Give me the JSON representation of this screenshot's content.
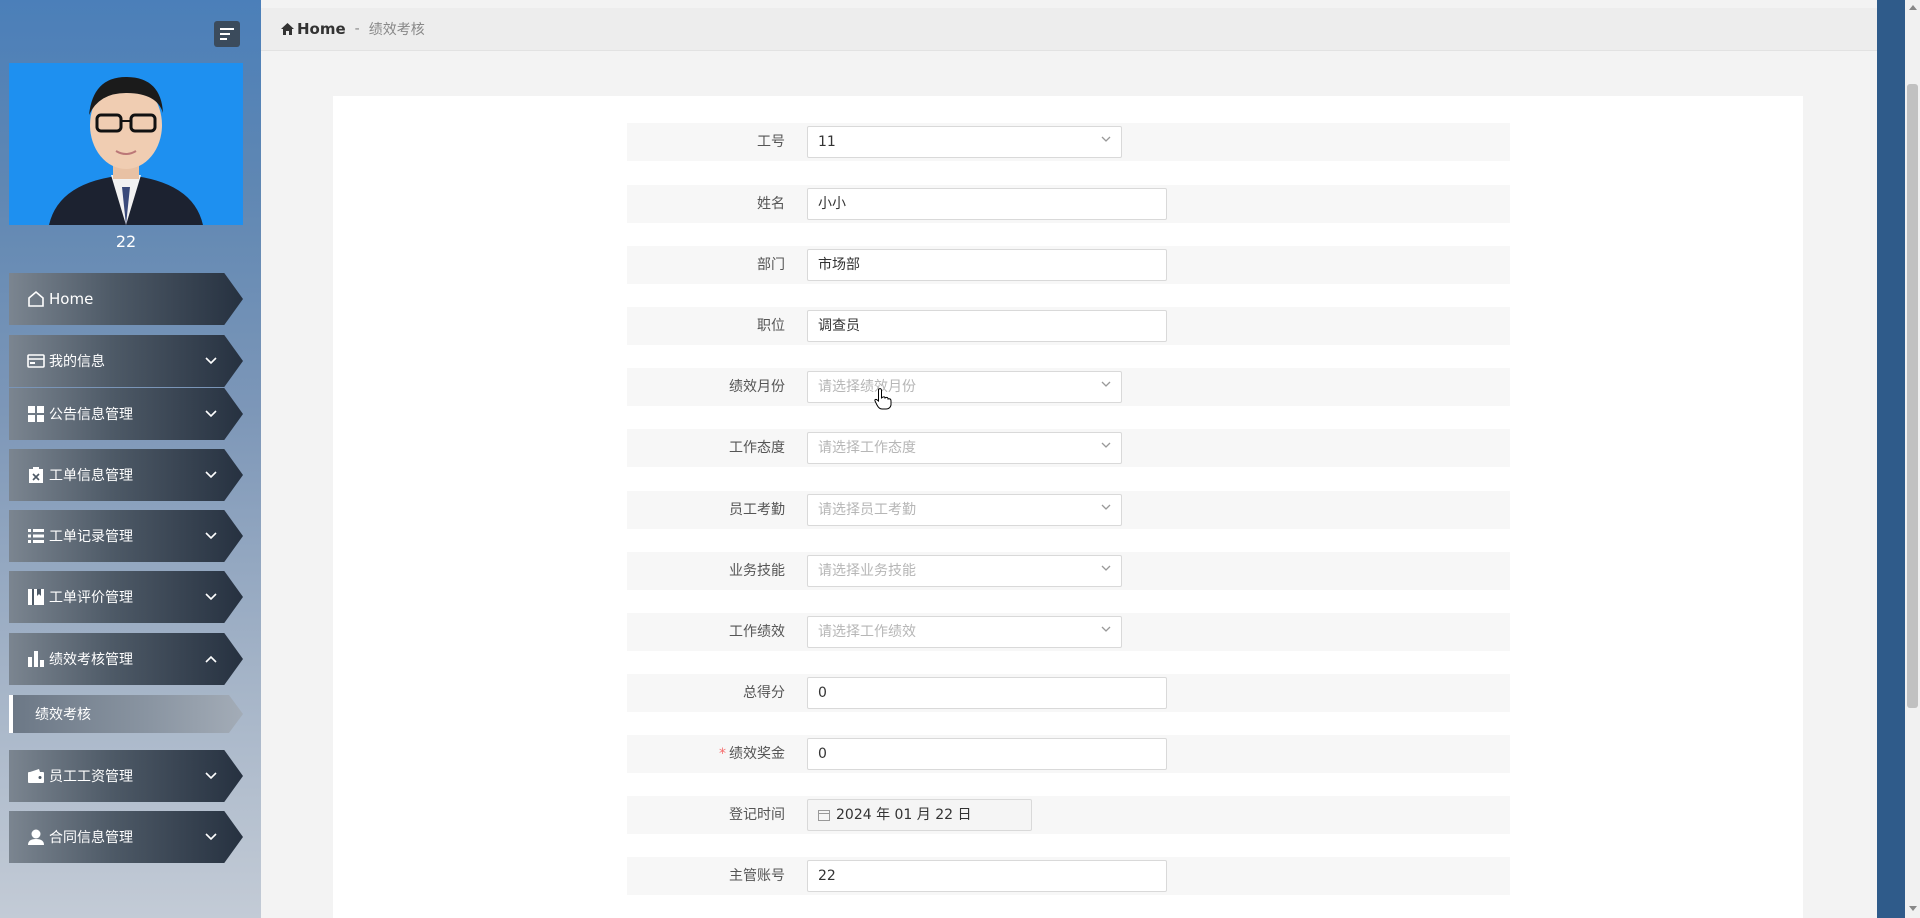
{
  "user": {
    "name": "22"
  },
  "breadcrumb": {
    "home": "Home",
    "separator": "-",
    "current": "绩效考核"
  },
  "nav": {
    "home": "Home",
    "items": [
      {
        "label": "我的信息",
        "icon": "id-card-icon",
        "expanded": false
      },
      {
        "label": "公告信息管理",
        "icon": "grid-icon",
        "expanded": false
      },
      {
        "label": "工单信息管理",
        "icon": "clipboard-icon",
        "expanded": false
      },
      {
        "label": "工单记录管理",
        "icon": "list-icon",
        "expanded": false
      },
      {
        "label": "工单评价管理",
        "icon": "book-icon",
        "expanded": false
      },
      {
        "label": "绩效考核管理",
        "icon": "bar-chart-icon",
        "expanded": true
      },
      {
        "label": "员工工资管理",
        "icon": "wallet-icon",
        "expanded": false
      },
      {
        "label": "合同信息管理",
        "icon": "user-icon",
        "expanded": false
      }
    ],
    "sub_active": "绩效考核"
  },
  "form": {
    "fields": [
      {
        "label": "工号",
        "type": "select",
        "value": "11",
        "placeholder": ""
      },
      {
        "label": "姓名",
        "type": "input",
        "value": "小小"
      },
      {
        "label": "部门",
        "type": "input",
        "value": "市场部"
      },
      {
        "label": "职位",
        "type": "input",
        "value": "调查员"
      },
      {
        "label": "绩效月份",
        "type": "select",
        "value": "",
        "placeholder": "请选择绩效月份"
      },
      {
        "label": "工作态度",
        "type": "select",
        "value": "",
        "placeholder": "请选择工作态度"
      },
      {
        "label": "员工考勤",
        "type": "select",
        "value": "",
        "placeholder": "请选择员工考勤"
      },
      {
        "label": "业务技能",
        "type": "select",
        "value": "",
        "placeholder": "请选择业务技能"
      },
      {
        "label": "工作绩效",
        "type": "select",
        "value": "",
        "placeholder": "请选择工作绩效"
      },
      {
        "label": "总得分",
        "type": "input",
        "value": "0"
      },
      {
        "label": "绩效奖金",
        "type": "input",
        "value": "0",
        "required": true
      },
      {
        "label": "登记时间",
        "type": "date",
        "value": "2024 年 01 月 22 日"
      },
      {
        "label": "主管账号",
        "type": "input",
        "value": "22"
      }
    ]
  },
  "colors": {
    "sidebar_top": "#4b7fb9",
    "nav_dark": "#263140",
    "required": "#f56c6c",
    "placeholder": "#b6b6b6"
  }
}
